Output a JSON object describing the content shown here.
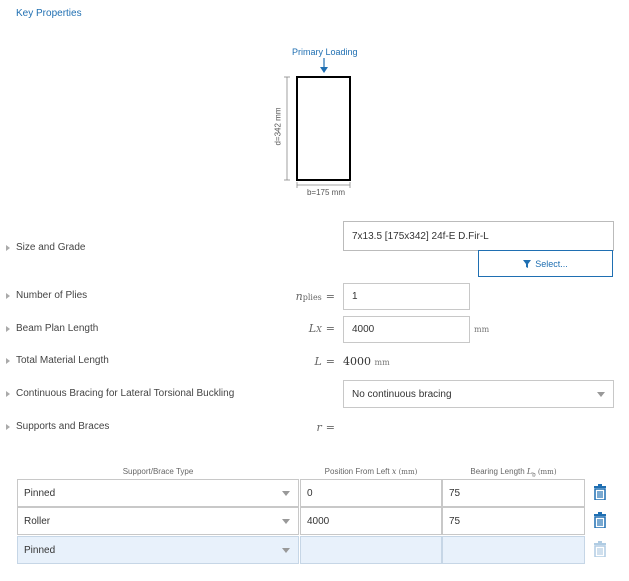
{
  "header": {
    "title": "Key Properties"
  },
  "diagram": {
    "loading_label": "Primary Loading",
    "depth_label": "d=342 mm",
    "width_label": "b=175 mm"
  },
  "size_grade": {
    "label": "Size and Grade",
    "value": "7x13.5 [175x342] 24f-E D.Fir-L",
    "select_button": "Select..."
  },
  "plies": {
    "label": "Number of Plies",
    "symbol": "n",
    "subscript": "plies",
    "value": "1"
  },
  "plan_length": {
    "label": "Beam Plan Length",
    "symbol": "L",
    "subscript": "X",
    "value": "4000",
    "unit": "mm"
  },
  "material_length": {
    "label": "Total Material Length",
    "symbol": "L",
    "value": "4000",
    "unit": "mm"
  },
  "bracing": {
    "label": "Continuous Bracing for Lateral Torsional Buckling",
    "value": "No continuous bracing"
  },
  "supports": {
    "label": "Supports and Braces",
    "symbol": "r",
    "headers": {
      "type": "Support/Brace Type",
      "position": "Position From Left",
      "position_sym": "x",
      "position_unit": "(mm)",
      "bearing": "Bearing Length",
      "bearing_sym": "L",
      "bearing_sub": "b",
      "bearing_unit": "(mm)"
    },
    "rows": [
      {
        "type": "Pinned",
        "position": "0",
        "bearing": "75"
      },
      {
        "type": "Roller",
        "position": "4000",
        "bearing": "75"
      },
      {
        "type": "Pinned",
        "position": "",
        "bearing": ""
      }
    ]
  },
  "colors": {
    "accent": "#1f6fb2",
    "trash": "#1f6fb2",
    "new_row": "#e8f1fb"
  }
}
